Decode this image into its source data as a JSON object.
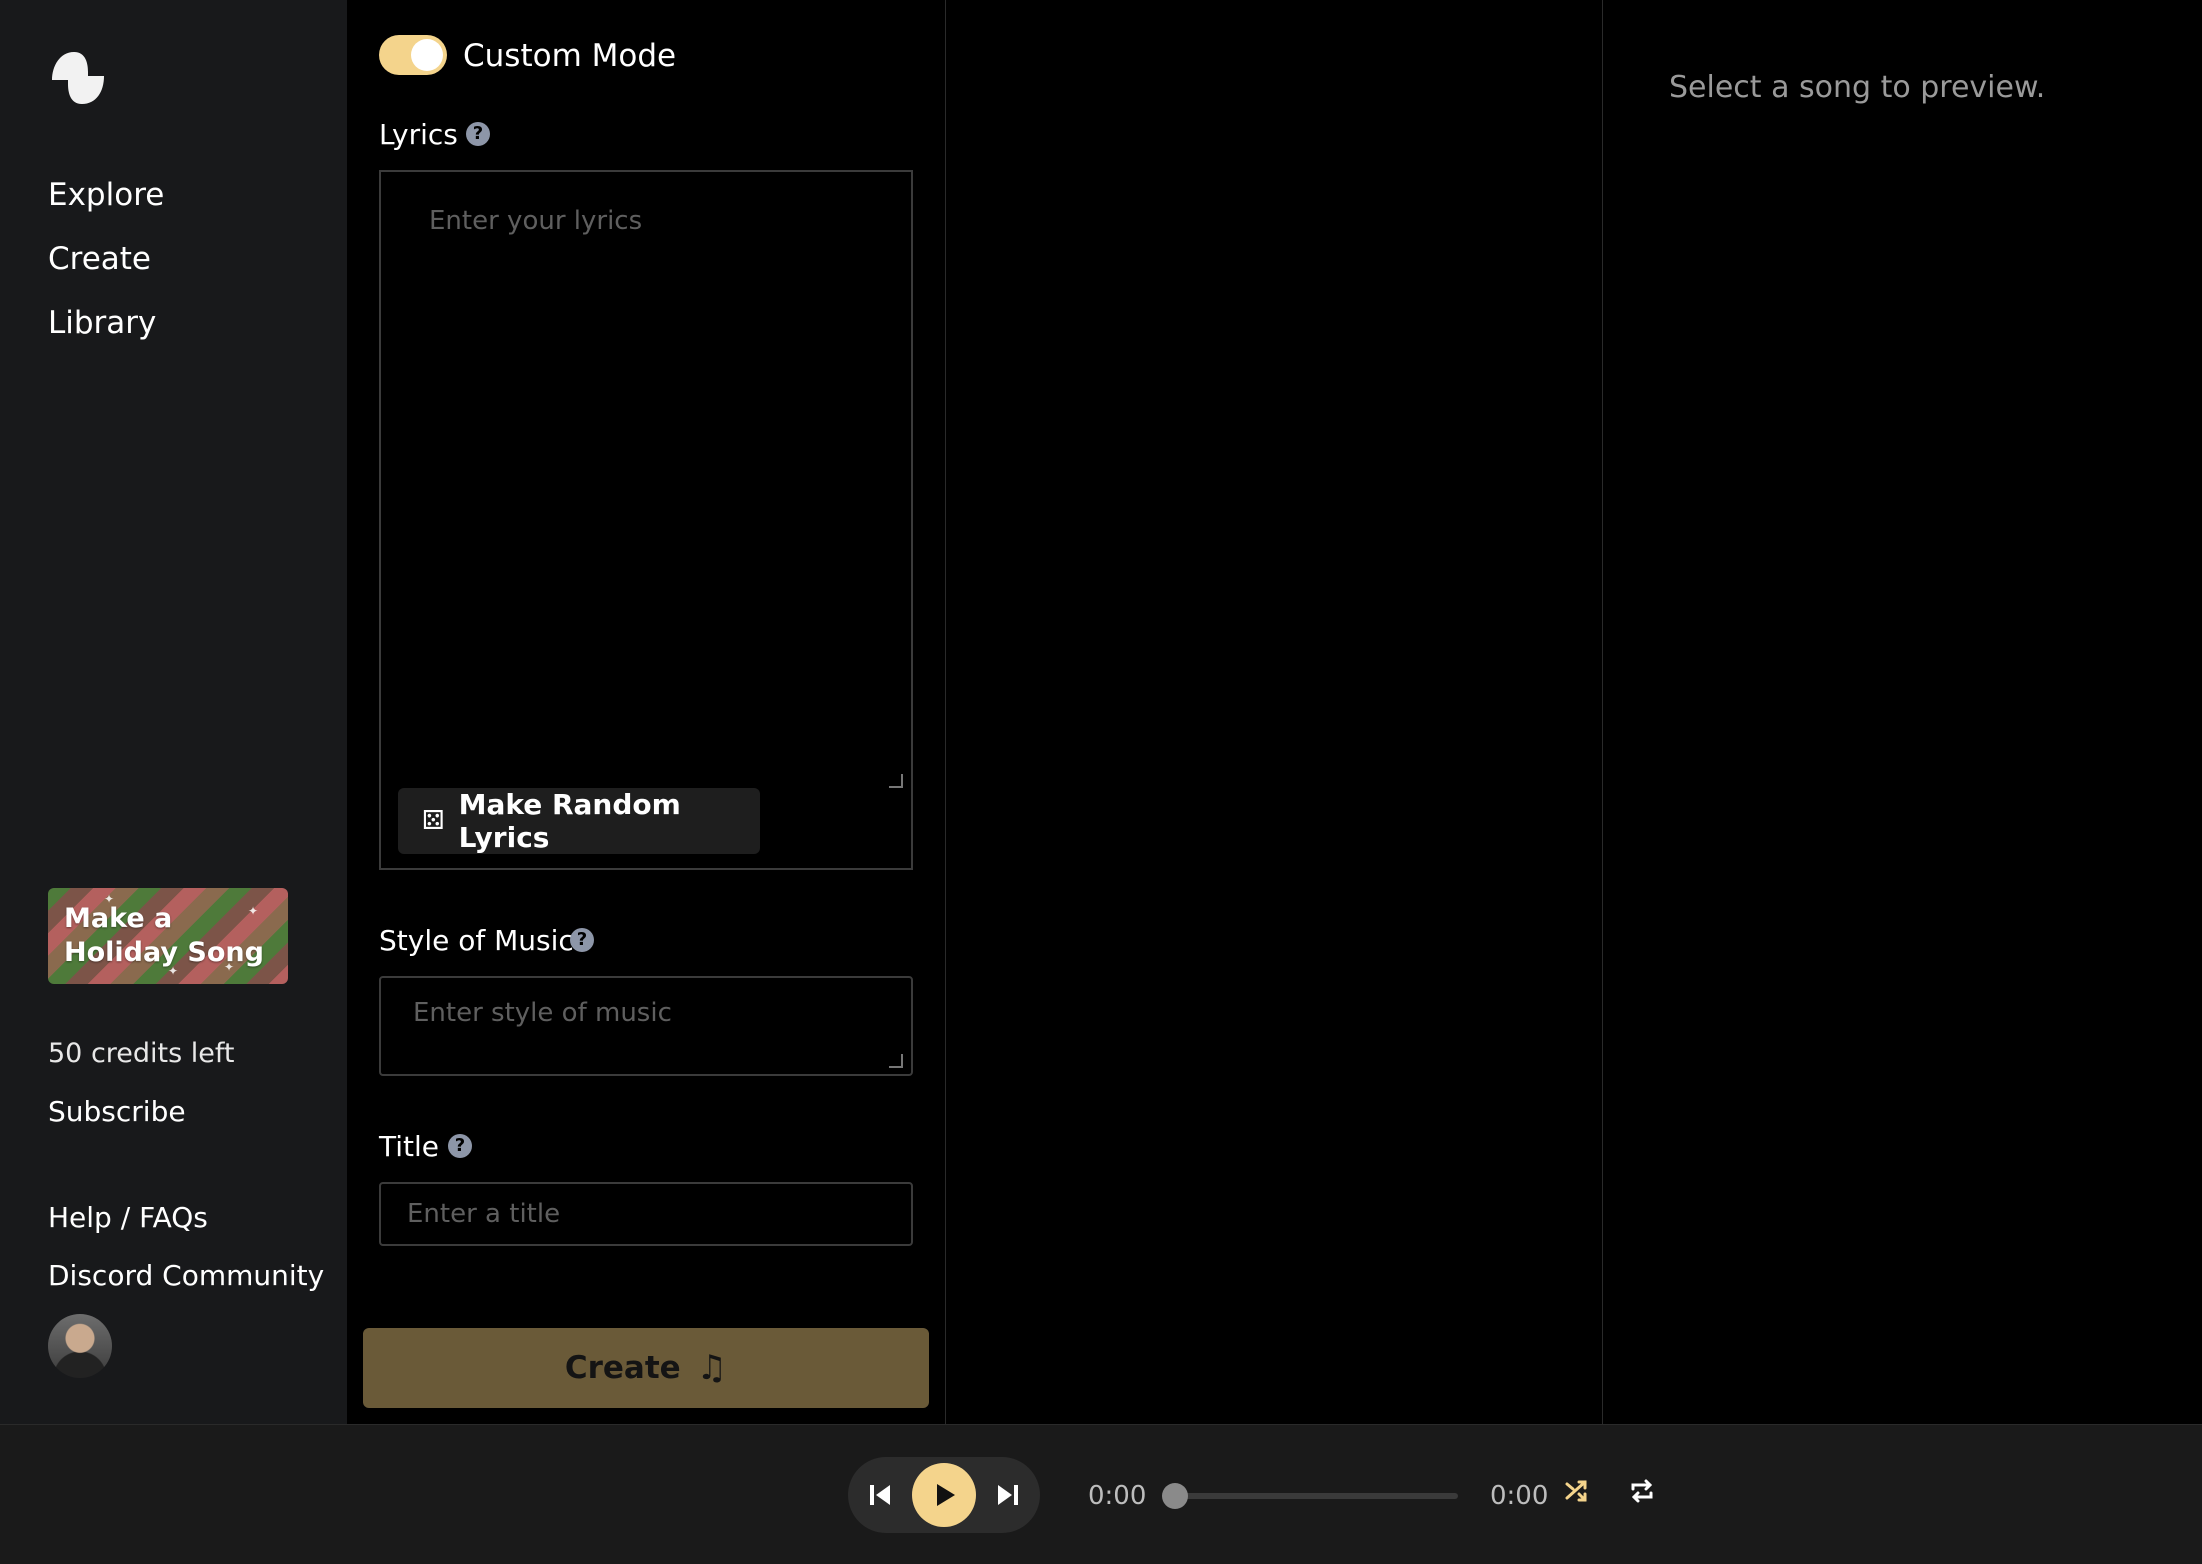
{
  "sidebar": {
    "logo": "suno-logo-icon",
    "nav": [
      {
        "label": "Explore"
      },
      {
        "label": "Create"
      },
      {
        "label": "Library"
      }
    ],
    "promo": {
      "label": "Make a Holiday Song"
    },
    "credits": "50 credits left",
    "subscribe": "Subscribe",
    "help": "Help / FAQs",
    "discord": "Discord Community"
  },
  "create": {
    "custom_mode_label": "Custom Mode",
    "custom_mode_on": true,
    "lyrics_label": "Lyrics",
    "lyrics_placeholder": "Enter your lyrics",
    "random_lyrics_button": "Make Random Lyrics",
    "style_label": "Style of Music",
    "style_placeholder": "Enter style of music",
    "title_label": "Title",
    "title_placeholder": "Enter a title",
    "create_button": "Create"
  },
  "preview": {
    "empty_text": "Select a song to preview."
  },
  "player": {
    "current_time": "0:00",
    "duration": "0:00",
    "progress": 0
  },
  "colors": {
    "accent": "#f4d48c",
    "sidebar_bg": "#18191b",
    "create_button_bg": "#6a5a38"
  }
}
